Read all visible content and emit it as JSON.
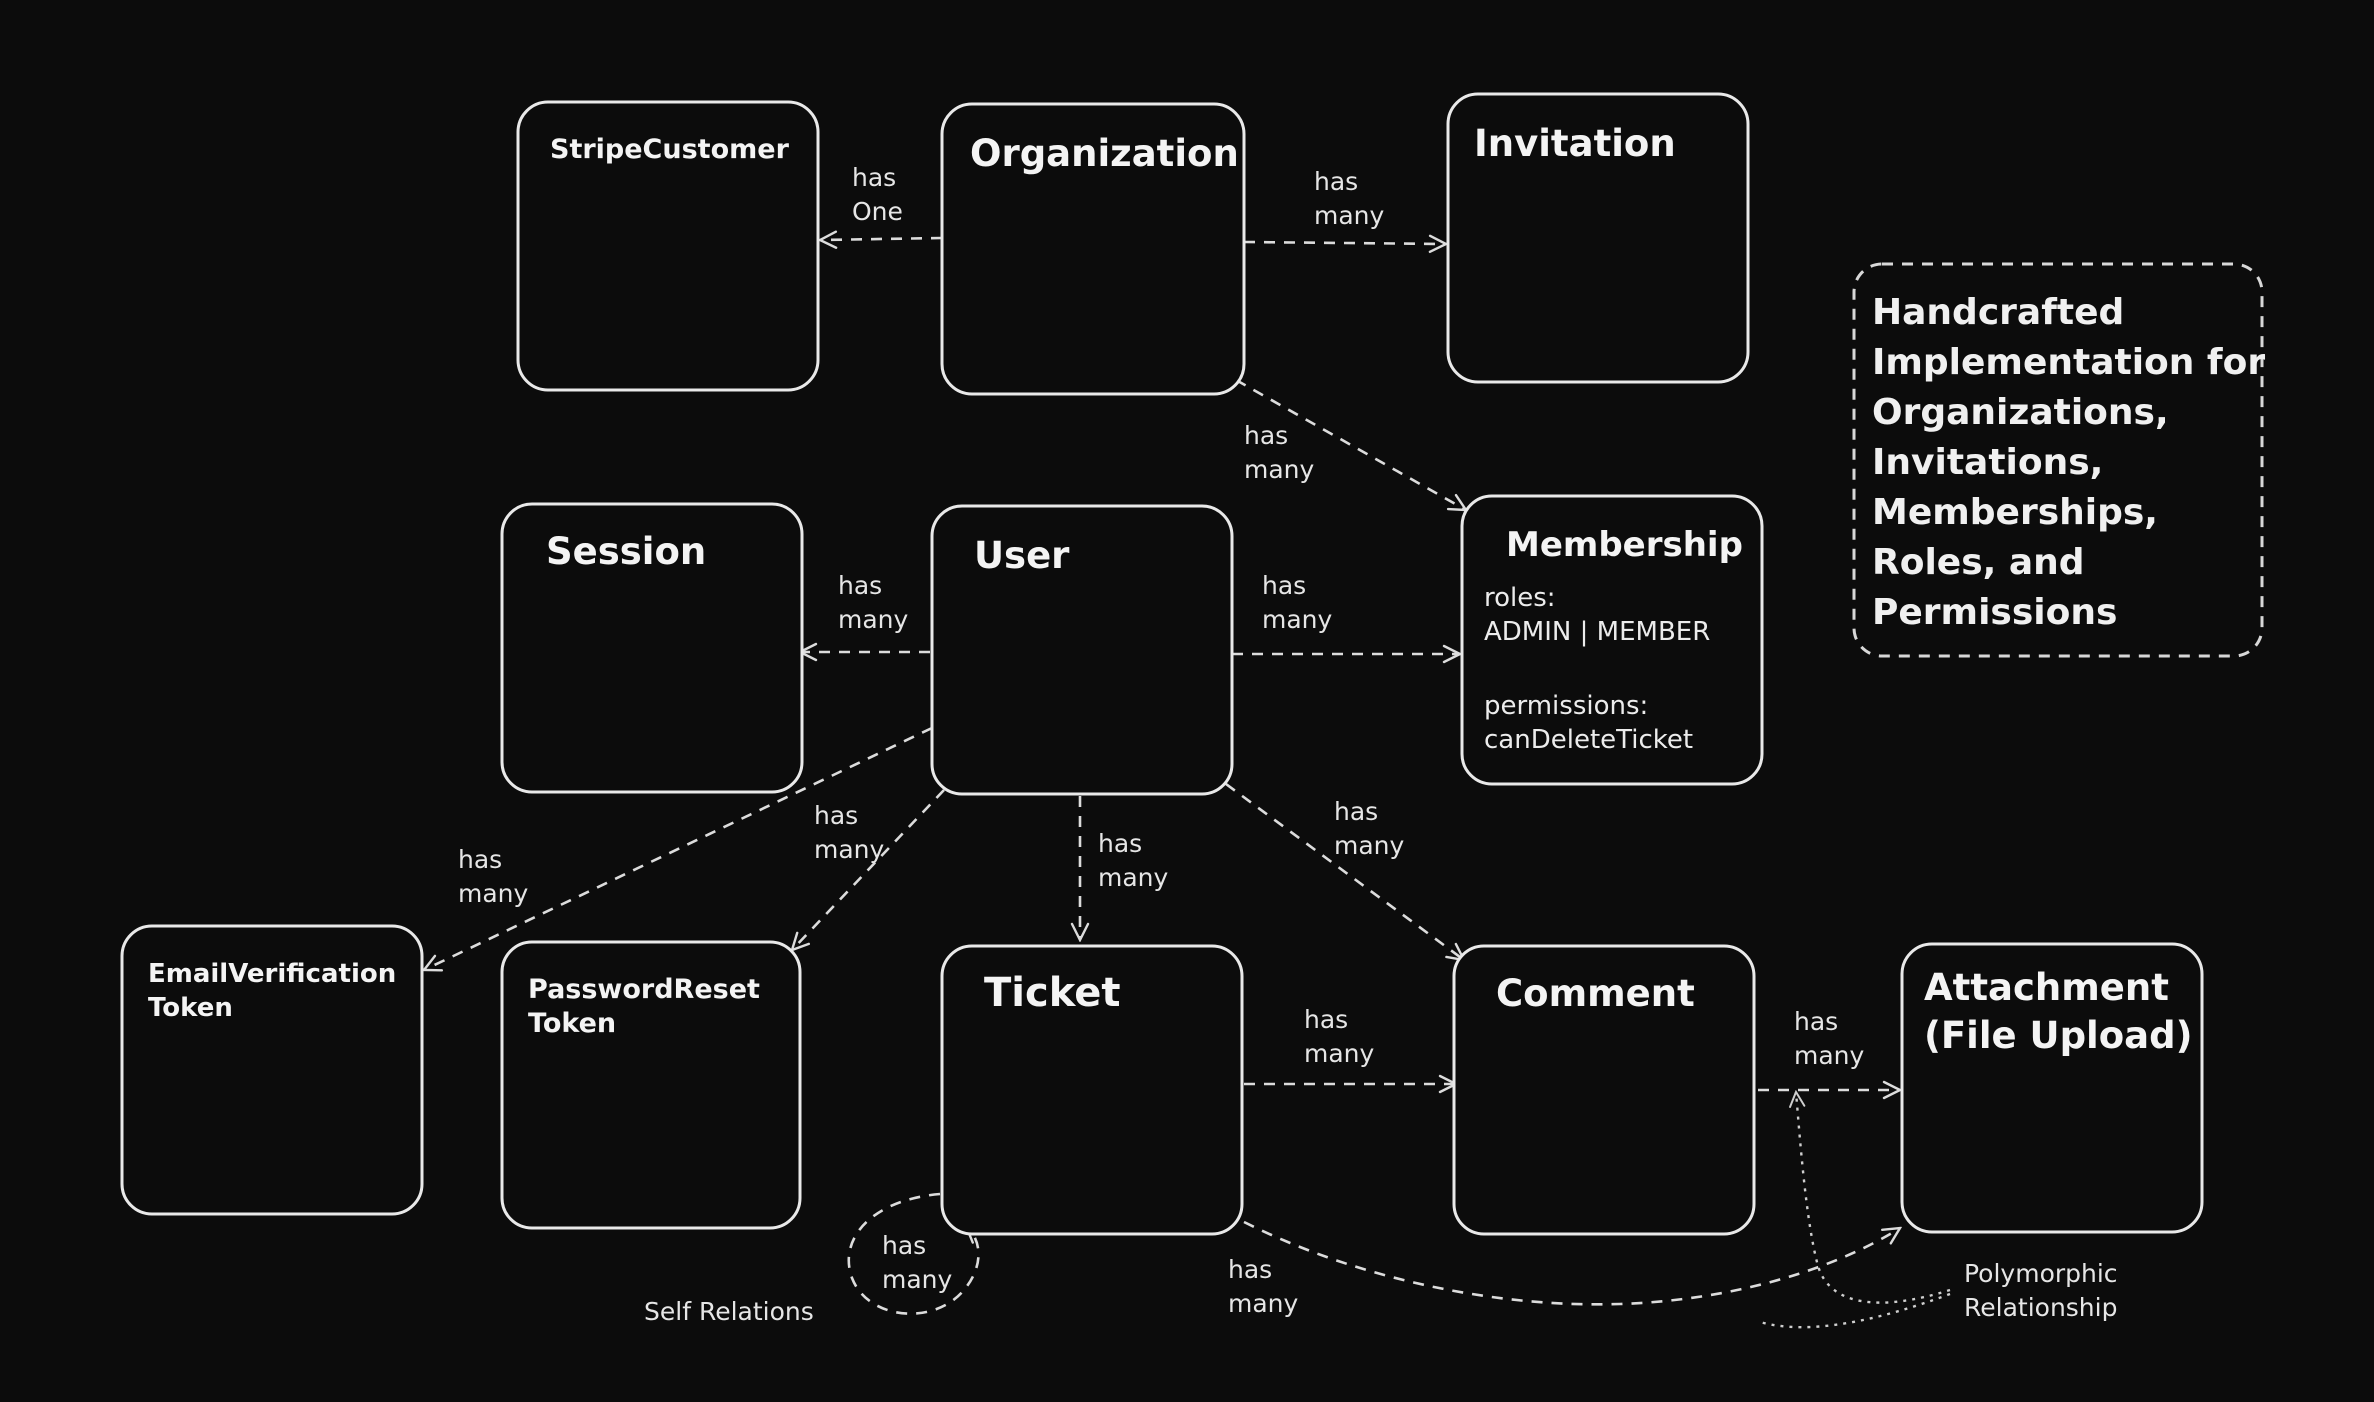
{
  "entities": {
    "stripe_customer": {
      "title": [
        "StripeCustomer"
      ]
    },
    "organization": {
      "title": [
        "Organization"
      ]
    },
    "invitation": {
      "title": [
        "Invitation"
      ]
    },
    "session": {
      "title": [
        "Session"
      ]
    },
    "user": {
      "title": [
        "User"
      ]
    },
    "membership": {
      "title": [
        "Membership"
      ],
      "body": [
        "roles:",
        "ADMIN | MEMBER",
        "",
        "permissions:",
        "canDeleteTicket"
      ]
    },
    "email_verification_token": {
      "title": [
        "EmailVerification",
        "Token"
      ]
    },
    "password_reset_token": {
      "title": [
        "PasswordReset",
        "Token"
      ]
    },
    "ticket": {
      "title": [
        "Ticket"
      ]
    },
    "comment": {
      "title": [
        "Comment"
      ]
    },
    "attachment": {
      "title": [
        "Attachment",
        "(File Upload)"
      ]
    }
  },
  "relations": {
    "org_stripe": [
      "has",
      "One"
    ],
    "org_invitation": [
      "has",
      "many"
    ],
    "org_membership": [
      "has",
      "many"
    ],
    "user_session": [
      "has",
      "many"
    ],
    "user_membership": [
      "has",
      "many"
    ],
    "user_email_token": [
      "has",
      "many"
    ],
    "user_password_token": [
      "has",
      "many"
    ],
    "user_ticket": [
      "has",
      "many"
    ],
    "user_comment": [
      "has",
      "many"
    ],
    "ticket_comment": [
      "has",
      "many"
    ],
    "comment_attachment": [
      "has",
      "many"
    ],
    "ticket_self": [
      "has",
      "many"
    ],
    "ticket_attachment": [
      "has",
      "many"
    ]
  },
  "annotations": {
    "self_relations": "Self Relations",
    "polymorphic": [
      "Polymorphic",
      "Relationship"
    ]
  },
  "note": {
    "lines": [
      "Handcrafted",
      "Implementation for",
      "Organizations,",
      "Invitations,",
      "Memberships,",
      "Roles, and",
      "Permissions"
    ]
  },
  "colors": {
    "background": "#0c0c0c",
    "stroke": "#e9e9e9",
    "text": "#f2f2f2"
  }
}
